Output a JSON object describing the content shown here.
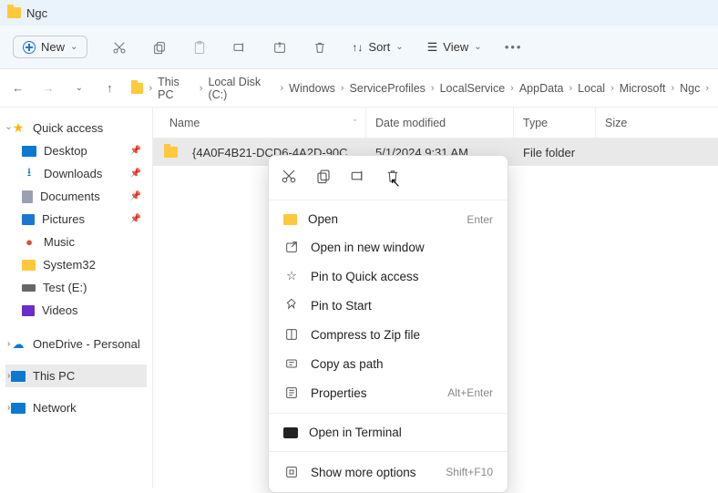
{
  "title": "Ngc",
  "toolbar": {
    "new_label": "New",
    "sort_label": "Sort",
    "view_label": "View"
  },
  "breadcrumb": [
    "This PC",
    "Local Disk (C:)",
    "Windows",
    "ServiceProfiles",
    "LocalService",
    "AppData",
    "Local",
    "Microsoft",
    "Ngc"
  ],
  "columns": {
    "name": "Name",
    "date": "Date modified",
    "type": "Type",
    "size": "Size"
  },
  "row": {
    "name": "{4A0F4B21-DCD6-4A2D-90C8-9C1AE96...",
    "date": "5/1/2024 9:31 AM",
    "type": "File folder",
    "size": ""
  },
  "sidebar": {
    "quick": "Quick access",
    "desktop": "Desktop",
    "downloads": "Downloads",
    "documents": "Documents",
    "pictures": "Pictures",
    "music": "Music",
    "system32": "System32",
    "test": "Test (E:)",
    "videos": "Videos",
    "onedrive": "OneDrive - Personal",
    "thispc": "This PC",
    "network": "Network"
  },
  "context": {
    "open": "Open",
    "open_hint": "Enter",
    "open_new": "Open in new window",
    "pin_quick": "Pin to Quick access",
    "pin_start": "Pin to Start",
    "compress": "Compress to Zip file",
    "copy_path": "Copy as path",
    "properties": "Properties",
    "properties_hint": "Alt+Enter",
    "terminal": "Open in Terminal",
    "more": "Show more options",
    "more_hint": "Shift+F10"
  }
}
